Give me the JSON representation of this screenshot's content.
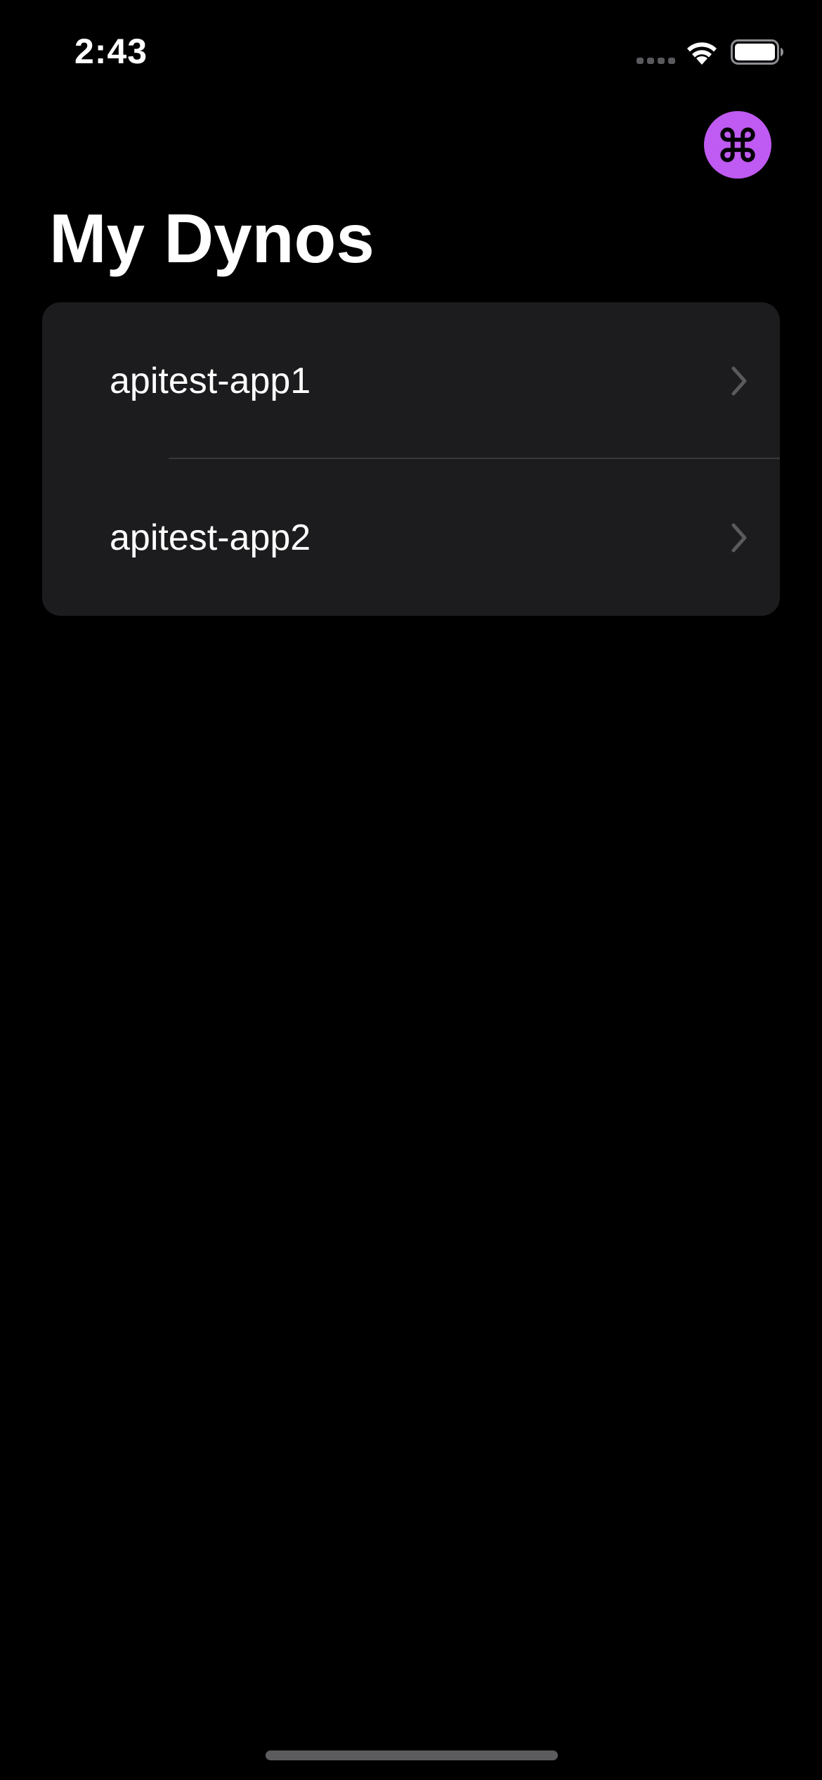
{
  "status_bar": {
    "time": "2:43"
  },
  "colors": {
    "background": "#000000",
    "card": "#1c1c1e",
    "accent": "#bf5af2",
    "chevron": "#5a5a5e",
    "divider": "#38383a",
    "home_indicator": "#5c5c5e"
  },
  "toolbar": {
    "command_button_icon": "command-icon"
  },
  "page": {
    "title": "My Dynos"
  },
  "dynos": {
    "items": [
      {
        "label": "apitest-app1",
        "icon": "chevron-right-icon"
      },
      {
        "label": "apitest-app2",
        "icon": "chevron-right-icon"
      }
    ]
  }
}
